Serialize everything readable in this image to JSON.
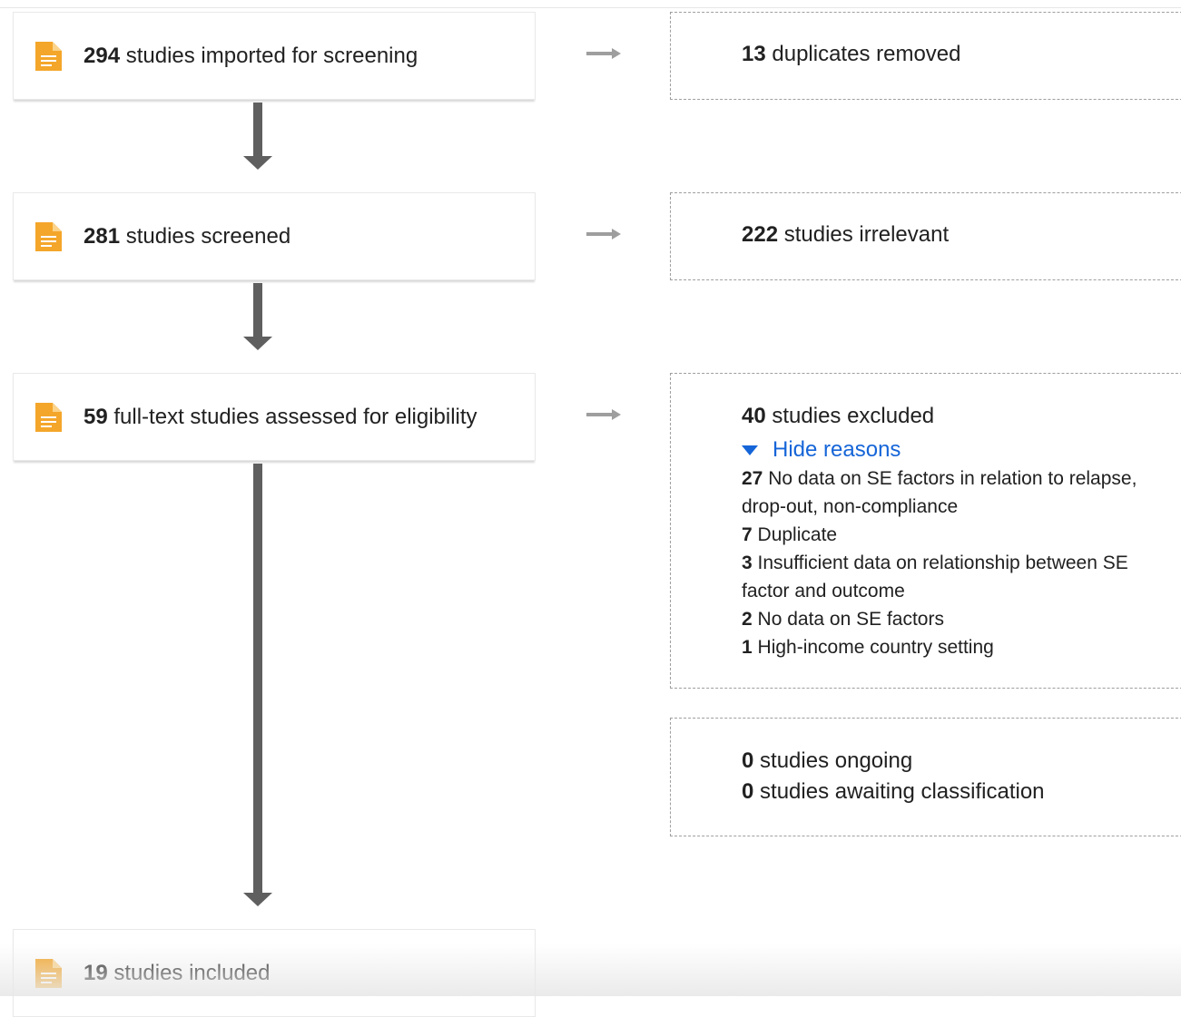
{
  "stages": [
    {
      "count": "294",
      "text": "studies imported for screening"
    },
    {
      "count": "281",
      "text": "studies screened"
    },
    {
      "count": "59",
      "text": "full-text studies assessed for eligibility"
    },
    {
      "count": "19",
      "text": "studies included"
    }
  ],
  "side": {
    "duplicates": {
      "count": "13",
      "text": "duplicates removed"
    },
    "irrelevant": {
      "count": "222",
      "text": "studies irrelevant"
    },
    "excluded": {
      "count": "40",
      "text": "studies excluded",
      "toggle_label": "Hide reasons",
      "reasons": [
        {
          "count": "27",
          "text": "No data on SE factors in relation to relapse, drop-out, non-compliance"
        },
        {
          "count": "7",
          "text": "Duplicate"
        },
        {
          "count": "3",
          "text": "Insufficient data on relationship between SE factor and outcome"
        },
        {
          "count": "2",
          "text": "No data on SE factors"
        },
        {
          "count": "1",
          "text": "High-income country setting"
        }
      ]
    },
    "ongoing": {
      "count": "0",
      "text": "studies ongoing"
    },
    "awaiting": {
      "count": "0",
      "text": "studies awaiting classification"
    }
  },
  "colors": {
    "icon": "#f4a62a",
    "link": "#1565d8",
    "arrow": "#5f5f5f"
  },
  "icons": {
    "stage": "document-icon",
    "flow": "arrow-right-icon",
    "toggle": "triangle-down-icon"
  }
}
